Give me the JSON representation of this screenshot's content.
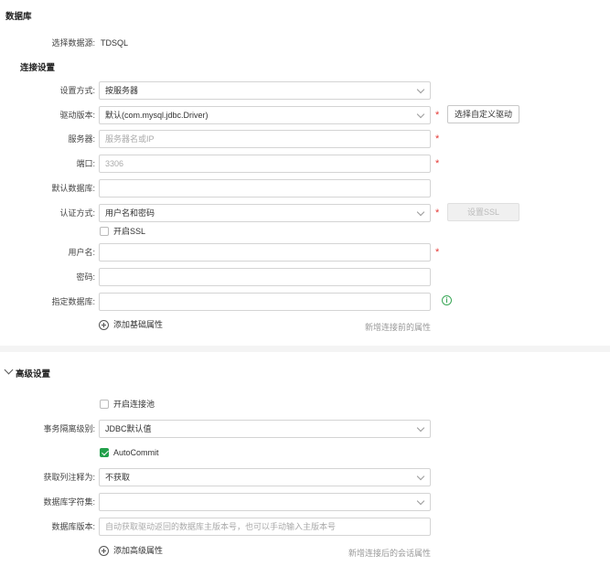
{
  "page": {
    "title": "数据库"
  },
  "source": {
    "label": "选择数据源:",
    "value": "TDSQL"
  },
  "connection": {
    "heading": "连接设置",
    "setup_mode": {
      "label": "设置方式:",
      "value": "按服务器"
    },
    "driver": {
      "label": "驱动版本:",
      "value": "默认(com.mysql.jdbc.Driver)",
      "button": "选择自定义驱动"
    },
    "server": {
      "label": "服务器:",
      "placeholder": "服务器名或IP"
    },
    "port": {
      "label": "端口:",
      "placeholder": "3306"
    },
    "default_db": {
      "label": "默认数据库:",
      "value": ""
    },
    "auth": {
      "label": "认证方式:",
      "value": "用户名和密码",
      "button": "设置SSL"
    },
    "ssl": {
      "label": "开启SSL",
      "checked": false
    },
    "username": {
      "label": "用户名:",
      "value": ""
    },
    "password": {
      "label": "密码:",
      "value": ""
    },
    "specified_db": {
      "label": "指定数据库:",
      "value": ""
    },
    "add_basic": "添加基础属性",
    "pre_note": "新增连接前的属性",
    "required_mark": "*"
  },
  "advanced": {
    "heading": "高级设置",
    "pool": {
      "label": "开启连接池",
      "checked": false
    },
    "isolation": {
      "label": "事务隔离级别:",
      "value": "JDBC默认值"
    },
    "autocommit": {
      "label": "AutoCommit",
      "checked": true
    },
    "comment": {
      "label": "获取列注释为:",
      "value": "不获取"
    },
    "charset": {
      "label": "数据库字符集:",
      "value": ""
    },
    "version": {
      "label": "数据库版本:",
      "placeholder": "自动获取驱动返回的数据库主版本号，也可以手动输入主版本号"
    },
    "add_advanced": "添加高级属性",
    "post_note": "新增连接后的会话属性"
  },
  "colors": {
    "required": "#e53935",
    "check": "#22a04b",
    "info": "#3aa757"
  }
}
